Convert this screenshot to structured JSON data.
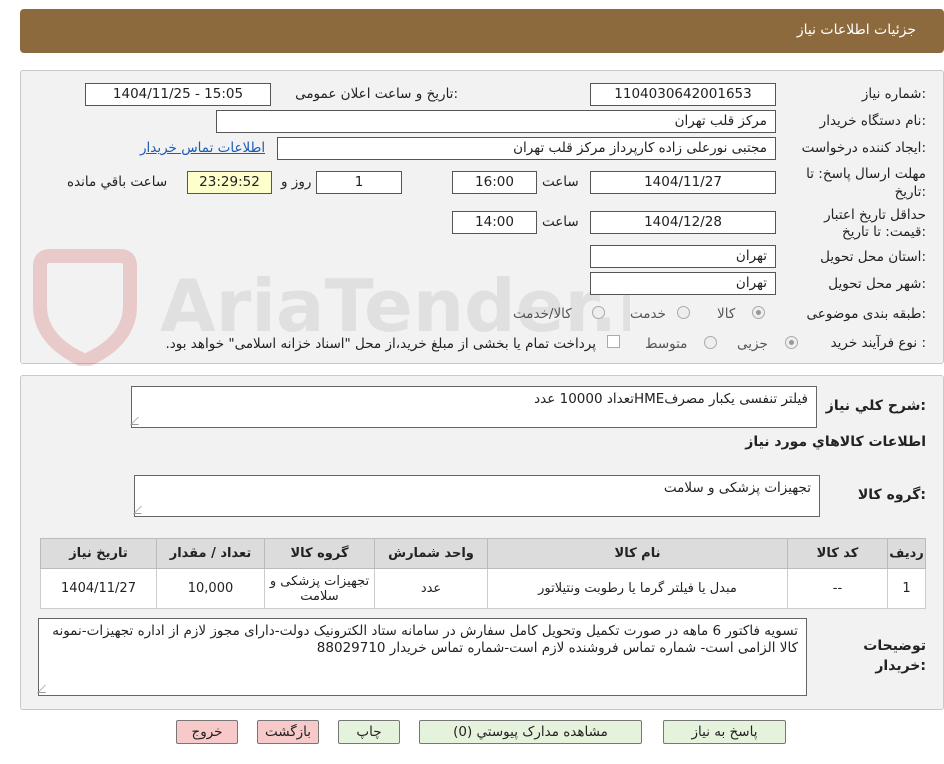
{
  "header": {
    "title": "جزئیات اطلاعات نیاز"
  },
  "fields": {
    "need_number_label": "شماره نیاز:",
    "need_number": "1104030642001653",
    "announce_label": "تاریخ و ساعت اعلان عمومی:",
    "announce_value": "1404/11/25 - 15:05",
    "buyer_org_label": "نام دستگاه خریدار:",
    "buyer_org": "مرکز قلب تهران",
    "requester_label": "ایجاد کننده درخواست:",
    "requester": "مجتبی نورعلی زاده کارپرداز مرکز قلب تهران",
    "contact_link": "اطلاعات تماس خریدار",
    "deadline_label_1": "مهلت ارسال پاسخ: تا",
    "deadline_label_2": "تاریخ:",
    "deadline_date": "1404/11/27",
    "time_label": "ساعت",
    "deadline_time": "16:00",
    "days_value": "1",
    "days_label": "روز و",
    "remaining_time": "23:29:52",
    "remaining_label": "ساعت باقي مانده",
    "validity_label_1": "حداقل تاریخ اعتبار",
    "validity_label_2": "قیمت: تا تاریخ:",
    "validity_date": "1404/12/28",
    "validity_time": "14:00",
    "province_label": "استان محل تحویل:",
    "province": "تهران",
    "city_label": "شهر محل تحویل:",
    "city": "تهران",
    "category_label": "طبقه بندی موضوعی:",
    "category_options": [
      "کالا",
      "خدمت",
      "کالا/خدمت"
    ],
    "process_label": "نوع فرآیند خرید :",
    "process_options": [
      "جزیی",
      "متوسط"
    ],
    "process_note": "پرداخت تمام یا بخشی از مبلغ خرید،از محل \"اسناد خزانه اسلامی\" خواهد بود."
  },
  "summary": {
    "label": "شرح کلي نياز:",
    "value": "فیلتر تنفسی یکبار مصرفHMEتعداد 10000 عدد",
    "items_title": "اطلاعات کالاهاي مورد نياز",
    "group_label": "گروه کالا:",
    "group_value": "تجهیزات پزشکی و سلامت"
  },
  "table": {
    "headers": [
      "رديف",
      "کد کالا",
      "نام کالا",
      "واحد شمارش",
      "گروه کالا",
      "تعداد / مقدار",
      "تاریخ نیاز"
    ],
    "rows": [
      [
        "1",
        "--",
        "مبدل یا فیلتر گرما یا رطوبت ونتیلاتور",
        "عدد",
        "تجهیزات پزشکی و سلامت",
        "10,000",
        "1404/11/27"
      ]
    ]
  },
  "notes": {
    "label_1": "توضیحات",
    "label_2": "خریدار:",
    "value": "تسویه فاکتور 6 ماهه در صورت تکمیل وتحویل کامل سفارش در سامانه  ستاد الکترونیک دولت-دارای مجوز لازم از اداره تجهیزات-نمونه کالا الزامی است- شماره تماس فروشنده لازم است-شماره تماس خریدار 88029710"
  },
  "buttons": {
    "reply": "پاسخ به نياز",
    "attachments": "مشاهده مدارک پیوستي (0)",
    "print": "چاپ",
    "back": "بازگشت",
    "exit": "خروج"
  },
  "watermark": {
    "text": "AriaTender.neT"
  },
  "colors": {
    "header_bg": "#8c6a3d",
    "button_green": "#e6f3dc",
    "button_pink": "#f7c9c9",
    "remaining_bg": "#ffffcc"
  }
}
